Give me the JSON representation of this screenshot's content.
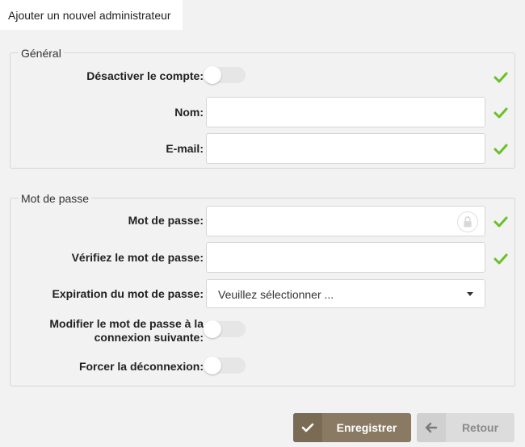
{
  "tab": {
    "title": "Ajouter un nouvel administrateur"
  },
  "general": {
    "legend": "Général",
    "disable_account_label": "Désactiver le compte:",
    "name_label": "Nom:",
    "email_label": "E-mail:",
    "name_value": "",
    "email_value": ""
  },
  "password": {
    "legend": "Mot de passe",
    "password_label": "Mot de passe:",
    "verify_label": "Vérifiez le mot de passe:",
    "expiration_label": "Expiration du mot de passe:",
    "expiration_selected": "Veuillez sélectionner ...",
    "change_next_login_label_line1": "Modifier le mot de passe à la",
    "change_next_login_label_line2": "connexion suivante:",
    "force_logout_label": "Forcer la déconnexion:"
  },
  "buttons": {
    "save": "Enregistrer",
    "back": "Retour"
  },
  "colors": {
    "check": "#6cbf2a",
    "save_bg": "#8a7a63",
    "back_bg": "#dcdcdc"
  },
  "icons": {
    "check": "check-icon",
    "lock": "lock-icon",
    "save": "save-check-icon",
    "back": "arrow-left-icon"
  }
}
